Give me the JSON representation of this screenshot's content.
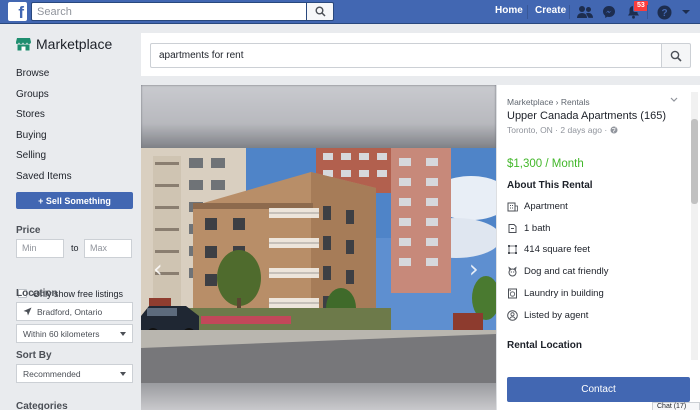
{
  "header": {
    "search_placeholder": "Search",
    "nav": [
      "Home",
      "Create"
    ],
    "notification_count": "53"
  },
  "sidebar": {
    "title": "Marketplace",
    "items": [
      "Browse",
      "Groups",
      "Stores",
      "Buying",
      "Selling",
      "Saved Items"
    ],
    "sell_button": "+ Sell Something",
    "price_heading": "Price",
    "min_placeholder": "Min",
    "to_label": "to",
    "max_placeholder": "Max",
    "free_listings_label": "Only show free listings",
    "location_heading": "Location",
    "location_value": "Bradford, Ontario",
    "radius_value": "Within 60 kilometers",
    "sort_heading": "Sort By",
    "sort_value": "Recommended",
    "categories_heading": "Categories"
  },
  "main": {
    "search_value": "apartments for rent"
  },
  "listing": {
    "breadcrumb": "Marketplace › Rentals",
    "title": "Upper Canada Apartments (165)",
    "meta": "Toronto, ON · 2 days ago ·",
    "price": "$1,300 / Month",
    "about_heading": "About This Rental",
    "attributes": [
      {
        "icon": "building-icon",
        "label": "Apartment"
      },
      {
        "icon": "bath-icon",
        "label": "1 bath"
      },
      {
        "icon": "area-icon",
        "label": "414 square feet"
      },
      {
        "icon": "pet-icon",
        "label": "Dog and cat friendly"
      },
      {
        "icon": "laundry-icon",
        "label": "Laundry in building"
      },
      {
        "icon": "agent-icon",
        "label": "Listed by agent"
      }
    ],
    "location_heading": "Rental Location",
    "contact_button": "Contact"
  },
  "chat": {
    "label": "Chat (17)"
  },
  "colors": {
    "brand": "#4267b2",
    "price": "#42b72a"
  }
}
